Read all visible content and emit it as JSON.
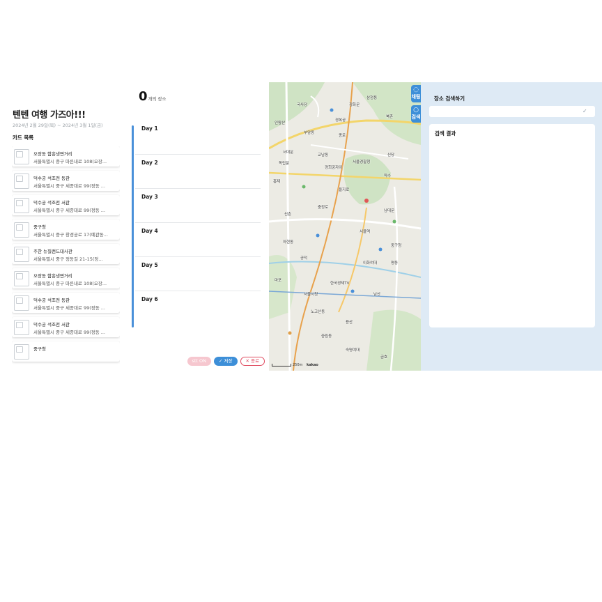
{
  "trip": {
    "title": "텐텐 여행 가즈아!!!",
    "dates": "2024년 2월 29일(목) ~ 2024년 3월 1일(금)",
    "card_heading": "카드 목록"
  },
  "cards": [
    {
      "name": "오장동 함흥냉면거리",
      "addr": "서울특별시 중구 마른내로 108(오장..."
    },
    {
      "name": "덕수궁 석조전 동관",
      "addr": "서울특별시 중구 세종대로 99(정동 ..."
    },
    {
      "name": "덕수궁 석조전 서관",
      "addr": "서울특별시 중구 세종대로 99(정동 ..."
    },
    {
      "name": "중구청",
      "addr": "서울특별시 중구 창경궁로 17(예관동..."
    },
    {
      "name": "주한 뉴질랜드대사관",
      "addr": "서울특별시 중구 정동길 21-15(정..."
    },
    {
      "name": "오장동 함흥냉면거리",
      "addr": "서울특별시 중구 마른내로 108(오장..."
    },
    {
      "name": "덕수궁 석조전 동관",
      "addr": "서울특별시 중구 세종대로 99(정동 ..."
    },
    {
      "name": "덕수궁 석조전 서관",
      "addr": "서울특별시 중구 세종대로 99(정동 ..."
    },
    {
      "name": "중구청",
      "addr": ""
    }
  ],
  "planner": {
    "count": "0",
    "count_label": "개의 장소",
    "days": [
      "Day 1",
      "Day 2",
      "Day 3",
      "Day 4",
      "Day 5",
      "Day 6"
    ],
    "stt_label": "stt ON",
    "save_label": "✓ 저장",
    "cancel_label": "✕ 종료"
  },
  "map": {
    "labels": [
      "국사당",
      "인왕산",
      "부암동",
      "삼청동",
      "북촌",
      "종로",
      "광화문",
      "경복궁",
      "서대문",
      "독립문",
      "교남동",
      "경희궁자이",
      "홍제",
      "신촌",
      "서울역",
      "남대문",
      "충정로",
      "아현동",
      "공덕",
      "마포",
      "용산",
      "남산",
      "중구청",
      "명동",
      "을지로",
      "신당",
      "약수",
      "한국경제TV",
      "숙명여대",
      "서울시청",
      "이화여대",
      "서울경찰청",
      "금호",
      "노고산동",
      "중림동"
    ],
    "scale": "250m",
    "brand": "kakao",
    "tabs": [
      {
        "glyph": "◌",
        "label": "채팅"
      },
      {
        "glyph": "○",
        "label": "검색"
      }
    ]
  },
  "search": {
    "heading": "장소 검색하기",
    "input_value": "",
    "check_icon": "check-icon",
    "results_heading": "검색 결과"
  }
}
